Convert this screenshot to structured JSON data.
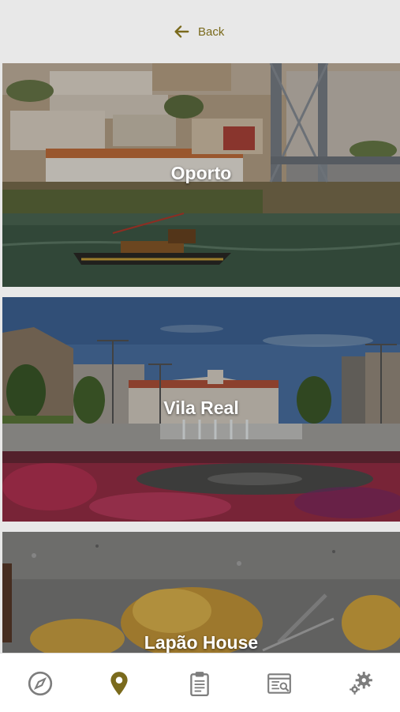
{
  "header": {
    "back_label": "Back"
  },
  "cards": [
    {
      "title": "Oporto"
    },
    {
      "title": "Vila Real"
    },
    {
      "title": "Lapão House"
    }
  ],
  "tabbar": {
    "items": [
      {
        "icon": "compass-icon",
        "active": false
      },
      {
        "icon": "location-pin-icon",
        "active": true
      },
      {
        "icon": "clipboard-icon",
        "active": false
      },
      {
        "icon": "news-icon",
        "active": false
      },
      {
        "icon": "gears-icon",
        "active": false
      }
    ]
  },
  "colors": {
    "accent": "#7a6a1c",
    "inactive_icon": "#7d7d7d",
    "background": "#e8e8e8"
  }
}
